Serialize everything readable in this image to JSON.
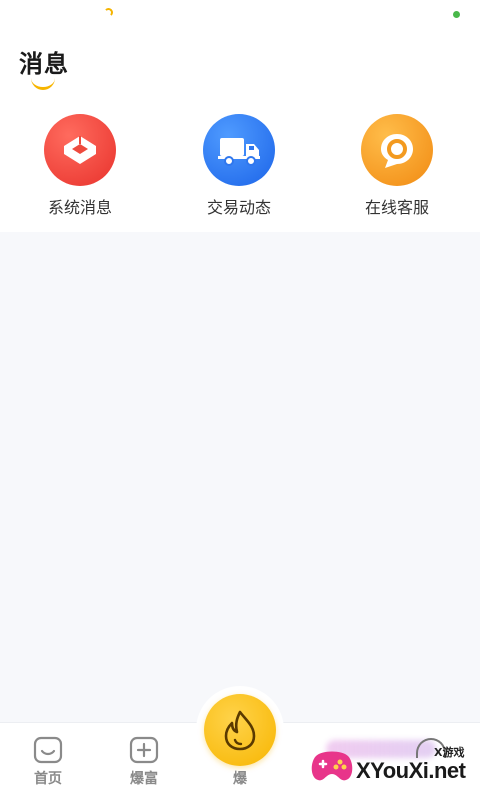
{
  "header": {
    "title": "消息"
  },
  "shortcuts": [
    {
      "label": "系统消息",
      "icon": "gift-box-icon",
      "color": "#e8322c"
    },
    {
      "label": "交易动态",
      "icon": "truck-icon",
      "color": "#1c64e8"
    },
    {
      "label": "在线客服",
      "icon": "chat-bubble-icon",
      "color": "#f18a12"
    }
  ],
  "bottom_nav": {
    "items": [
      {
        "label": "首页",
        "icon": "home-icon"
      },
      {
        "label": "爆富",
        "icon": "plus-box-icon"
      },
      {
        "label": "爆",
        "icon": "flame-icon"
      }
    ]
  },
  "watermark": {
    "small_text": "X游戏",
    "main_text": "XYouXi.net"
  },
  "colors": {
    "accent": "#f7b500",
    "background": "#f7f8fb"
  }
}
